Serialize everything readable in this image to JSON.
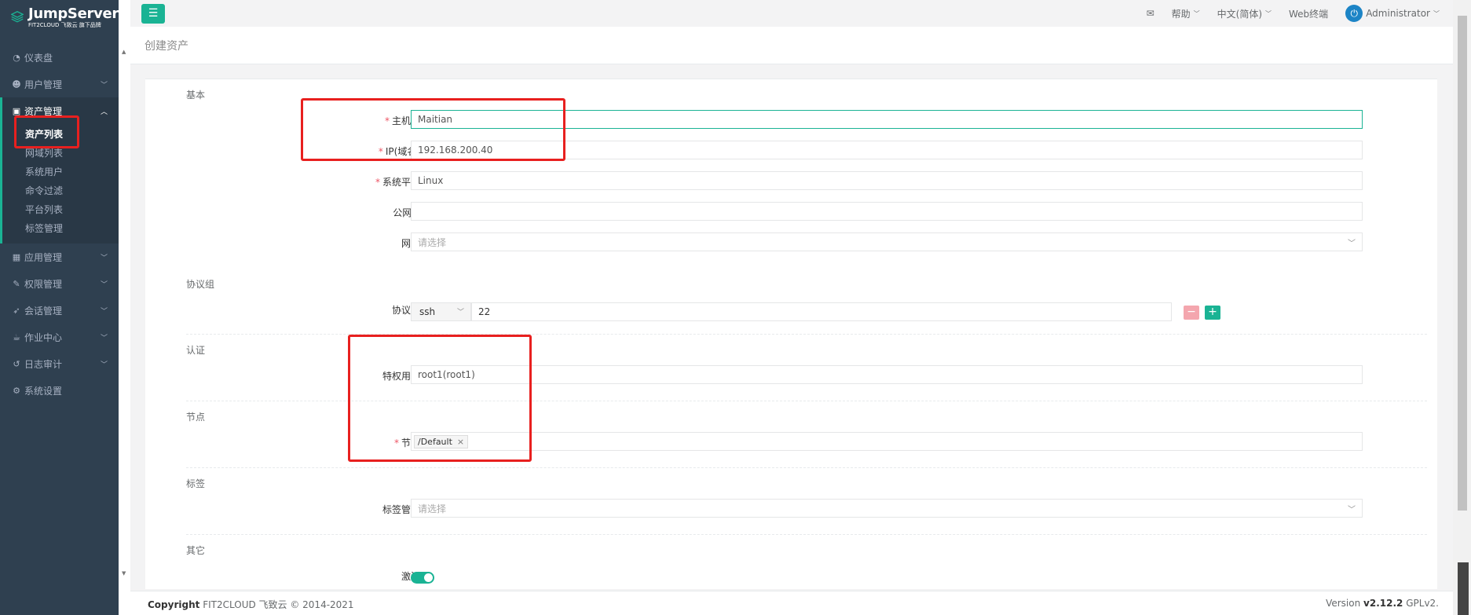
{
  "brand": {
    "title": "JumpServer",
    "subtitle": "FIT2CLOUD 飞致云 旗下品牌"
  },
  "sidebar": {
    "items": [
      {
        "label": "仪表盘",
        "icon": "dashboard-icon"
      },
      {
        "label": "用户管理",
        "icon": "users-icon"
      },
      {
        "label": "资产管理",
        "icon": "inbox-icon"
      },
      {
        "label": "应用管理",
        "icon": "grid-icon"
      },
      {
        "label": "权限管理",
        "icon": "edit-icon"
      },
      {
        "label": "会话管理",
        "icon": "rocket-icon"
      },
      {
        "label": "作业中心",
        "icon": "coffee-icon"
      },
      {
        "label": "日志审计",
        "icon": "history-icon"
      },
      {
        "label": "系统设置",
        "icon": "gears-icon"
      }
    ],
    "subitems": [
      "资产列表",
      "网域列表",
      "系统用户",
      "命令过滤",
      "平台列表",
      "标签管理"
    ]
  },
  "topbar": {
    "help": "帮助",
    "language": "中文(简体)",
    "web_terminal": "Web终端",
    "user": "Administrator"
  },
  "page": {
    "title": "创建资产"
  },
  "form": {
    "sections": {
      "basic": "基本",
      "protocols": "协议组",
      "auth": "认证",
      "nodes": "节点",
      "labels": "标签",
      "other": "其它"
    },
    "hostname_label": "主机名",
    "hostname_value": "Maitian",
    "ip_label": "IP(域名)",
    "ip_value": "192.168.200.40",
    "platform_label": "系统平台",
    "platform_value": "Linux",
    "public_ip_label": "公网IP",
    "public_ip_value": "",
    "domain_label": "网域",
    "domain_placeholder": "请选择",
    "protocol_label": "协议组",
    "protocol_value": "ssh",
    "port_value": "22",
    "admin_user_label": "特权用户",
    "admin_user_value": "root1(root1)",
    "node_label": "节点",
    "node_value": "/Default",
    "labels_label": "标签管理",
    "labels_placeholder": "请选择",
    "active_label": "激活",
    "active": true,
    "required_mark": "*"
  },
  "footer": {
    "copyright_bold": "Copyright",
    "copyright_text": "FIT2CLOUD 飞致云 © 2014-2021",
    "version_label": "Version",
    "version_value": "v2.12.2",
    "license": "GPLv2."
  },
  "colors": {
    "accent": "#1ab394",
    "sidebar_bg": "#2f4050",
    "highlight": "#e8201f",
    "danger": "#ed5565"
  }
}
